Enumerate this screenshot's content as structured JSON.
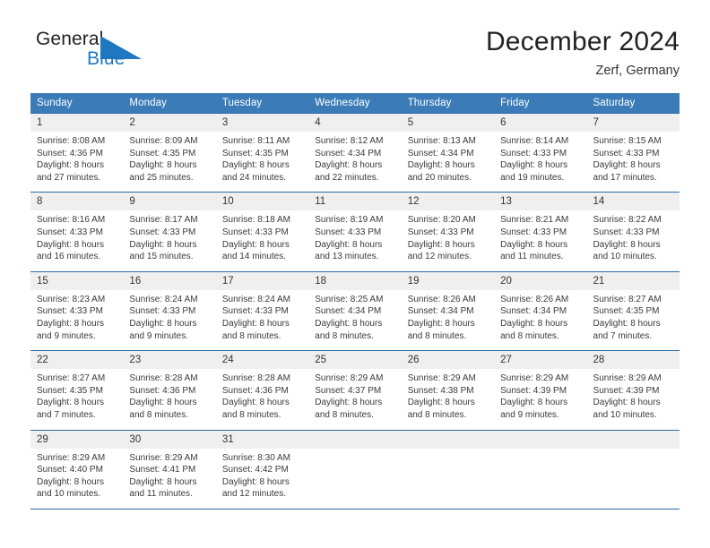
{
  "logo": {
    "text_primary": "General",
    "text_secondary": "Blue",
    "triangle_icon": "blue-triangle-icon",
    "primary_color": "#231f20",
    "secondary_color": "#1f77c2"
  },
  "header": {
    "month_title": "December 2024",
    "location": "Zerf, Germany"
  },
  "theme": {
    "header_bg": "#3b7cb8",
    "header_text": "#ffffff",
    "row_separator": "#2b6ca8",
    "daynum_bg": "#efefef",
    "body_text": "#3a3a3a"
  },
  "calendar": {
    "weekday_headers": [
      "Sunday",
      "Monday",
      "Tuesday",
      "Wednesday",
      "Thursday",
      "Friday",
      "Saturday"
    ],
    "weeks": [
      [
        {
          "day": "1",
          "sunrise": "Sunrise: 8:08 AM",
          "sunset": "Sunset: 4:36 PM",
          "daylight_line1": "Daylight: 8 hours",
          "daylight_line2": "and 27 minutes."
        },
        {
          "day": "2",
          "sunrise": "Sunrise: 8:09 AM",
          "sunset": "Sunset: 4:35 PM",
          "daylight_line1": "Daylight: 8 hours",
          "daylight_line2": "and 25 minutes."
        },
        {
          "day": "3",
          "sunrise": "Sunrise: 8:11 AM",
          "sunset": "Sunset: 4:35 PM",
          "daylight_line1": "Daylight: 8 hours",
          "daylight_line2": "and 24 minutes."
        },
        {
          "day": "4",
          "sunrise": "Sunrise: 8:12 AM",
          "sunset": "Sunset: 4:34 PM",
          "daylight_line1": "Daylight: 8 hours",
          "daylight_line2": "and 22 minutes."
        },
        {
          "day": "5",
          "sunrise": "Sunrise: 8:13 AM",
          "sunset": "Sunset: 4:34 PM",
          "daylight_line1": "Daylight: 8 hours",
          "daylight_line2": "and 20 minutes."
        },
        {
          "day": "6",
          "sunrise": "Sunrise: 8:14 AM",
          "sunset": "Sunset: 4:33 PM",
          "daylight_line1": "Daylight: 8 hours",
          "daylight_line2": "and 19 minutes."
        },
        {
          "day": "7",
          "sunrise": "Sunrise: 8:15 AM",
          "sunset": "Sunset: 4:33 PM",
          "daylight_line1": "Daylight: 8 hours",
          "daylight_line2": "and 17 minutes."
        }
      ],
      [
        {
          "day": "8",
          "sunrise": "Sunrise: 8:16 AM",
          "sunset": "Sunset: 4:33 PM",
          "daylight_line1": "Daylight: 8 hours",
          "daylight_line2": "and 16 minutes."
        },
        {
          "day": "9",
          "sunrise": "Sunrise: 8:17 AM",
          "sunset": "Sunset: 4:33 PM",
          "daylight_line1": "Daylight: 8 hours",
          "daylight_line2": "and 15 minutes."
        },
        {
          "day": "10",
          "sunrise": "Sunrise: 8:18 AM",
          "sunset": "Sunset: 4:33 PM",
          "daylight_line1": "Daylight: 8 hours",
          "daylight_line2": "and 14 minutes."
        },
        {
          "day": "11",
          "sunrise": "Sunrise: 8:19 AM",
          "sunset": "Sunset: 4:33 PM",
          "daylight_line1": "Daylight: 8 hours",
          "daylight_line2": "and 13 minutes."
        },
        {
          "day": "12",
          "sunrise": "Sunrise: 8:20 AM",
          "sunset": "Sunset: 4:33 PM",
          "daylight_line1": "Daylight: 8 hours",
          "daylight_line2": "and 12 minutes."
        },
        {
          "day": "13",
          "sunrise": "Sunrise: 8:21 AM",
          "sunset": "Sunset: 4:33 PM",
          "daylight_line1": "Daylight: 8 hours",
          "daylight_line2": "and 11 minutes."
        },
        {
          "day": "14",
          "sunrise": "Sunrise: 8:22 AM",
          "sunset": "Sunset: 4:33 PM",
          "daylight_line1": "Daylight: 8 hours",
          "daylight_line2": "and 10 minutes."
        }
      ],
      [
        {
          "day": "15",
          "sunrise": "Sunrise: 8:23 AM",
          "sunset": "Sunset: 4:33 PM",
          "daylight_line1": "Daylight: 8 hours",
          "daylight_line2": "and 9 minutes."
        },
        {
          "day": "16",
          "sunrise": "Sunrise: 8:24 AM",
          "sunset": "Sunset: 4:33 PM",
          "daylight_line1": "Daylight: 8 hours",
          "daylight_line2": "and 9 minutes."
        },
        {
          "day": "17",
          "sunrise": "Sunrise: 8:24 AM",
          "sunset": "Sunset: 4:33 PM",
          "daylight_line1": "Daylight: 8 hours",
          "daylight_line2": "and 8 minutes."
        },
        {
          "day": "18",
          "sunrise": "Sunrise: 8:25 AM",
          "sunset": "Sunset: 4:34 PM",
          "daylight_line1": "Daylight: 8 hours",
          "daylight_line2": "and 8 minutes."
        },
        {
          "day": "19",
          "sunrise": "Sunrise: 8:26 AM",
          "sunset": "Sunset: 4:34 PM",
          "daylight_line1": "Daylight: 8 hours",
          "daylight_line2": "and 8 minutes."
        },
        {
          "day": "20",
          "sunrise": "Sunrise: 8:26 AM",
          "sunset": "Sunset: 4:34 PM",
          "daylight_line1": "Daylight: 8 hours",
          "daylight_line2": "and 8 minutes."
        },
        {
          "day": "21",
          "sunrise": "Sunrise: 8:27 AM",
          "sunset": "Sunset: 4:35 PM",
          "daylight_line1": "Daylight: 8 hours",
          "daylight_line2": "and 7 minutes."
        }
      ],
      [
        {
          "day": "22",
          "sunrise": "Sunrise: 8:27 AM",
          "sunset": "Sunset: 4:35 PM",
          "daylight_line1": "Daylight: 8 hours",
          "daylight_line2": "and 7 minutes."
        },
        {
          "day": "23",
          "sunrise": "Sunrise: 8:28 AM",
          "sunset": "Sunset: 4:36 PM",
          "daylight_line1": "Daylight: 8 hours",
          "daylight_line2": "and 8 minutes."
        },
        {
          "day": "24",
          "sunrise": "Sunrise: 8:28 AM",
          "sunset": "Sunset: 4:36 PM",
          "daylight_line1": "Daylight: 8 hours",
          "daylight_line2": "and 8 minutes."
        },
        {
          "day": "25",
          "sunrise": "Sunrise: 8:29 AM",
          "sunset": "Sunset: 4:37 PM",
          "daylight_line1": "Daylight: 8 hours",
          "daylight_line2": "and 8 minutes."
        },
        {
          "day": "26",
          "sunrise": "Sunrise: 8:29 AM",
          "sunset": "Sunset: 4:38 PM",
          "daylight_line1": "Daylight: 8 hours",
          "daylight_line2": "and 8 minutes."
        },
        {
          "day": "27",
          "sunrise": "Sunrise: 8:29 AM",
          "sunset": "Sunset: 4:39 PM",
          "daylight_line1": "Daylight: 8 hours",
          "daylight_line2": "and 9 minutes."
        },
        {
          "day": "28",
          "sunrise": "Sunrise: 8:29 AM",
          "sunset": "Sunset: 4:39 PM",
          "daylight_line1": "Daylight: 8 hours",
          "daylight_line2": "and 10 minutes."
        }
      ],
      [
        {
          "day": "29",
          "sunrise": "Sunrise: 8:29 AM",
          "sunset": "Sunset: 4:40 PM",
          "daylight_line1": "Daylight: 8 hours",
          "daylight_line2": "and 10 minutes."
        },
        {
          "day": "30",
          "sunrise": "Sunrise: 8:29 AM",
          "sunset": "Sunset: 4:41 PM",
          "daylight_line1": "Daylight: 8 hours",
          "daylight_line2": "and 11 minutes."
        },
        {
          "day": "31",
          "sunrise": "Sunrise: 8:30 AM",
          "sunset": "Sunset: 4:42 PM",
          "daylight_line1": "Daylight: 8 hours",
          "daylight_line2": "and 12 minutes."
        },
        {
          "day": "",
          "sunrise": "",
          "sunset": "",
          "daylight_line1": "",
          "daylight_line2": ""
        },
        {
          "day": "",
          "sunrise": "",
          "sunset": "",
          "daylight_line1": "",
          "daylight_line2": ""
        },
        {
          "day": "",
          "sunrise": "",
          "sunset": "",
          "daylight_line1": "",
          "daylight_line2": ""
        },
        {
          "day": "",
          "sunrise": "",
          "sunset": "",
          "daylight_line1": "",
          "daylight_line2": ""
        }
      ]
    ]
  }
}
